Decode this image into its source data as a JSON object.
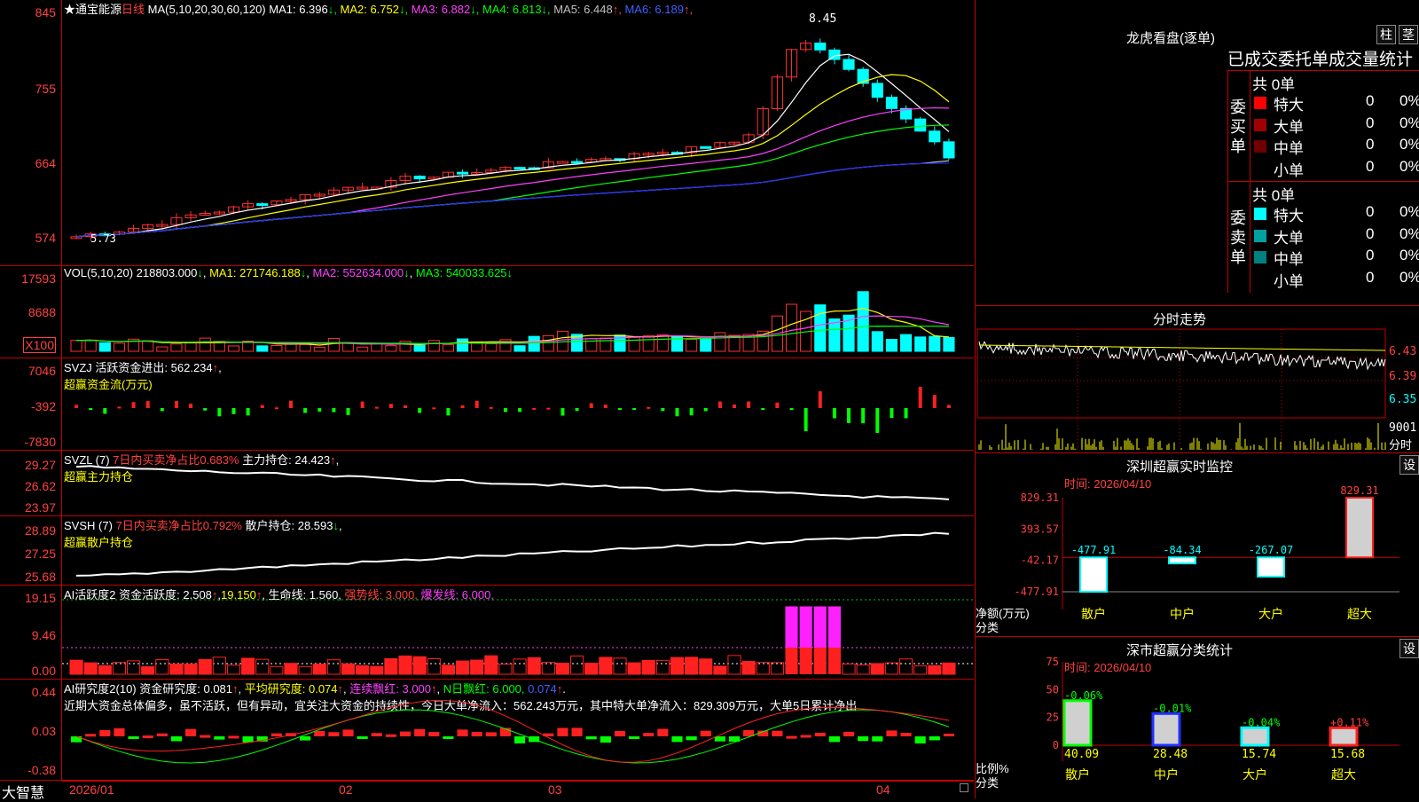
{
  "app": {
    "brand": "大智慧",
    "lock_icon": "lock-icon"
  },
  "main": {
    "title": "★通宝能源",
    "period": "日线",
    "ma_text": "MA(5,10,20,30,60,120)",
    "ma": [
      {
        "label": "MA1:",
        "value": "6.396",
        "arrow": "↓",
        "color": "#ffffff"
      },
      {
        "label": "MA2:",
        "value": "6.752",
        "arrow": "↓",
        "color": "#ffff00"
      },
      {
        "label": "MA3:",
        "value": "6.882",
        "arrow": "↓",
        "color": "#ff40ff"
      },
      {
        "label": "MA4:",
        "value": "6.813",
        "arrow": "↓",
        "color": "#00ff00"
      },
      {
        "label": "MA5:",
        "value": "6.448",
        "arrow": "↑",
        "color": "#c0c0c0"
      },
      {
        "label": "MA6:",
        "value": "6.189",
        "arrow": "↑",
        "color": "#4060ff"
      }
    ],
    "yticks": [
      "845",
      "755",
      "664",
      "574"
    ],
    "high_label": "8.45",
    "low_label": "5.73"
  },
  "vol": {
    "text": "VOL(5,10,20)",
    "value": "218803.000",
    "arrow": "↓",
    "ma": [
      {
        "label": "MA1:",
        "value": "271746.188",
        "arrow": "↓"
      },
      {
        "label": "MA2:",
        "value": "552634.000",
        "arrow": "↓"
      },
      {
        "label": "MA3:",
        "value": "540033.625",
        "arrow": "↓"
      }
    ],
    "yticks": [
      "17593",
      "8688"
    ],
    "unit": "X100"
  },
  "svzj": {
    "text": "SVZJ  活跃资金进出:",
    "value": "562.234",
    "arrow": "↑",
    "sub": "超赢资金流(万元)",
    "yticks": [
      "7046",
      "-392",
      "-7830"
    ]
  },
  "svzl": {
    "text": "SVZL (7)",
    "ratio": "7日内买卖净占比0.683%",
    "hold_label": "主力持仓:",
    "hold": "24.423",
    "arrow": "↑",
    "sub": "超赢主力持仓",
    "yticks": [
      "29.27",
      "26.62",
      "23.97"
    ]
  },
  "svsh": {
    "text": "SVSH (7)",
    "ratio": "7日内买卖净占比0.792%",
    "hold_label": "散户持仓:",
    "hold": "28.593",
    "arrow": "↓",
    "sub": "超赢散户持仓",
    "yticks": [
      "28.89",
      "27.25",
      "25.68"
    ]
  },
  "ai1": {
    "text": "AI活跃度2 资金活跃度:",
    "value": "2.508",
    "v2": "19.150",
    "life": "生命线: 1.560,",
    "strong": "强势线: 3.000,",
    "burst": "爆发线: 6.000,",
    "yticks": [
      "19.15",
      "9.46",
      "0.00"
    ]
  },
  "ai2": {
    "text": "AI研究度2(10) 资金研究度:",
    "value": "0.081",
    "avg": "平均研究度: 0.074",
    "red": "连续飘红: 3.000",
    "nred": "N日飘红: 6.000,",
    "last": "0.074",
    "comment": "近期大资金总体偏多，虽不活跃，但有异动，宜关注大资金的持续性，今日大单净流入：562.243万元，其中特大单净流入：829.309万元，大单5日累计净出",
    "yticks": [
      "0.44",
      "0.03",
      "-0.38"
    ]
  },
  "xaxis": [
    "2026/01",
    "02",
    "03",
    "04"
  ],
  "dragon": {
    "title": "龙虎看盘(逐单)",
    "btn1": "柱",
    "btn2": "茎",
    "header": "已成交委托单成交量统计",
    "buy_label": "委买单",
    "sell_label": "委卖单",
    "buy_total": "共 0单",
    "sell_total": "共 0单",
    "buy_rows": [
      {
        "name": "特大",
        "n": "0",
        "p": "0%",
        "c": "#ff0000"
      },
      {
        "name": "大单",
        "n": "0",
        "p": "0%",
        "c": "#a00000"
      },
      {
        "name": "中单",
        "n": "0",
        "p": "0%",
        "c": "#700000"
      },
      {
        "name": "小单",
        "n": "0",
        "p": "0%",
        "c": "#000000"
      }
    ],
    "sell_rows": [
      {
        "name": "特大",
        "n": "0",
        "p": "0%",
        "c": "#00ffff"
      },
      {
        "name": "大单",
        "n": "0",
        "p": "0%",
        "c": "#00a0a0"
      },
      {
        "name": "中单",
        "n": "0",
        "p": "0%",
        "c": "#008080"
      },
      {
        "name": "小单",
        "n": "0",
        "p": "0%",
        "c": "#000000"
      }
    ]
  },
  "intraday": {
    "title": "分时走势",
    "yticks": [
      "6.43",
      "6.39",
      "6.35"
    ],
    "vol": "9001",
    "unit": "分时"
  },
  "monitor": {
    "title": "深圳超赢实时监控",
    "btn": "设",
    "time": "时间: 2026/04/10",
    "yticks": [
      "829.31",
      "393.57",
      "-42.17",
      "-477.91"
    ],
    "label1": "净额(万元)",
    "label2": "分类",
    "cats": [
      "散户",
      "中户",
      "大户",
      "超大"
    ],
    "values": [
      -477.91,
      -84.34,
      -267.07,
      829.31
    ],
    "value_labels": [
      "-477.91",
      "-84.34",
      "-267.07",
      "829.31"
    ]
  },
  "stat": {
    "title": "深市超赢分类统计",
    "btn": "设",
    "time": "时间: 2026/04/10",
    "yticks": [
      "75",
      "50",
      "25",
      "0"
    ],
    "label1": "比例%",
    "label2": "分类",
    "cats": [
      "散户",
      "中户",
      "大户",
      "超大"
    ],
    "values": [
      40.09,
      28.48,
      15.74,
      15.68
    ],
    "changes": [
      "-0.06%",
      "-0.01%",
      "-0.04%",
      "+0.11%"
    ],
    "colors": [
      "#00ff00",
      "#2030ff",
      "#00ffff",
      "#ff2020"
    ]
  },
  "chart_data": {
    "type": "bar",
    "title": "深圳超赢实时监控",
    "categories": [
      "散户",
      "中户",
      "大户",
      "超大"
    ],
    "series": [
      {
        "name": "净额(万元)",
        "values": [
          -477.91,
          -84.34,
          -267.07,
          829.31
        ]
      },
      {
        "name": "比例%",
        "values": [
          40.09,
          28.48,
          15.74,
          15.68
        ]
      }
    ]
  }
}
